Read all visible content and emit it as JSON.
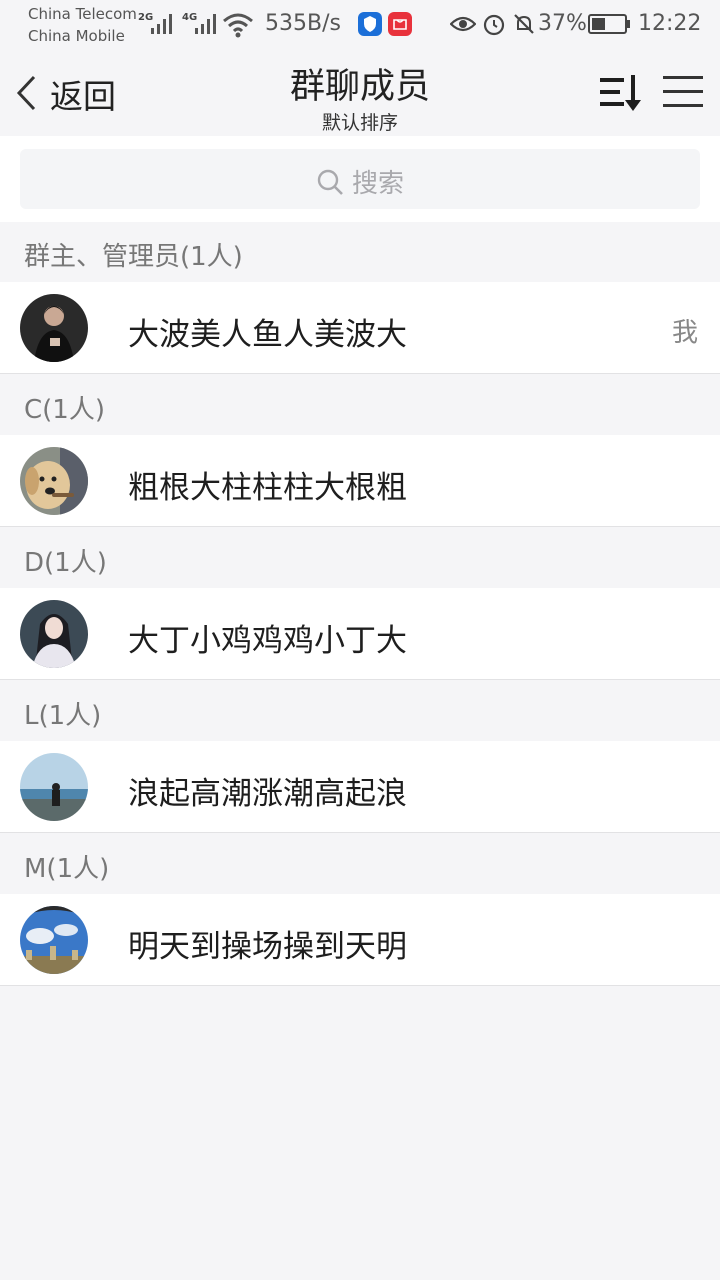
{
  "status_bar": {
    "carrier_1": "China Telecom",
    "carrier_2": "China Mobile",
    "network_1": "2G",
    "network_2": "4G",
    "speed": "535B/s",
    "battery": "37%",
    "time": "12:22"
  },
  "header": {
    "back_label": "返回",
    "title": "群聊成员",
    "subtitle": "默认排序"
  },
  "search": {
    "placeholder": "搜索"
  },
  "sections": [
    {
      "label": "群主、管理员(1人)",
      "members": [
        {
          "name": "大波美人鱼人美波大",
          "tag": "我"
        }
      ]
    },
    {
      "label": "C(1人)",
      "members": [
        {
          "name": "粗根大柱柱柱大根粗"
        }
      ]
    },
    {
      "label": "D(1人)",
      "members": [
        {
          "name": "大丁小鸡鸡鸡小丁大"
        }
      ]
    },
    {
      "label": "L(1人)",
      "members": [
        {
          "name": "浪起高潮涨潮高起浪"
        }
      ]
    },
    {
      "label": "M(1人)",
      "members": [
        {
          "name": "明天到操场操到天明"
        }
      ]
    }
  ],
  "colors": {
    "background": "#f5f5f7",
    "row": "#ffffff",
    "section_text": "#777777"
  }
}
